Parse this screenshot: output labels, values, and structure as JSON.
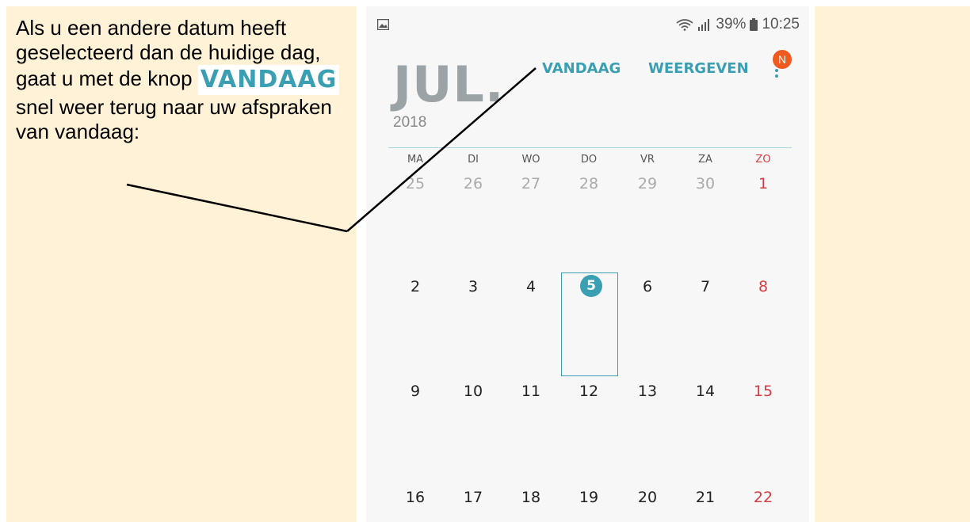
{
  "instruction": {
    "text_before": "Als u een andere datum heeft geselecteerd dan de huidige dag, gaat u met de knop",
    "button_label": "VANDAAG",
    "text_after": "snel weer terug naar uw afspraken van vandaag:"
  },
  "status_bar": {
    "battery": "39%",
    "time": "10:25",
    "icons": [
      "gallery-icon",
      "wifi-icon",
      "signal-icon",
      "battery-icon"
    ]
  },
  "header": {
    "month": "JUL.",
    "year": "2018",
    "today_button": "VANDAAG",
    "view_button": "WEERGEVEN",
    "avatar_letter": "N"
  },
  "calendar": {
    "weekdays": [
      "MA",
      "DI",
      "WO",
      "DO",
      "VR",
      "ZA",
      "ZO"
    ],
    "weeks": [
      [
        "25",
        "26",
        "27",
        "28",
        "29",
        "30",
        "1"
      ],
      [
        "2",
        "3",
        "4",
        "5",
        "6",
        "7",
        "8"
      ],
      [
        "9",
        "10",
        "11",
        "12",
        "13",
        "14",
        "15"
      ],
      [
        "16",
        "17",
        "18",
        "19",
        "20",
        "21",
        "22"
      ]
    ],
    "today": "5"
  },
  "colors": {
    "accent": "#3a9fb3",
    "sunday": "#d73b42",
    "panel": "#fff2d6",
    "avatar": "#f05a1e"
  }
}
